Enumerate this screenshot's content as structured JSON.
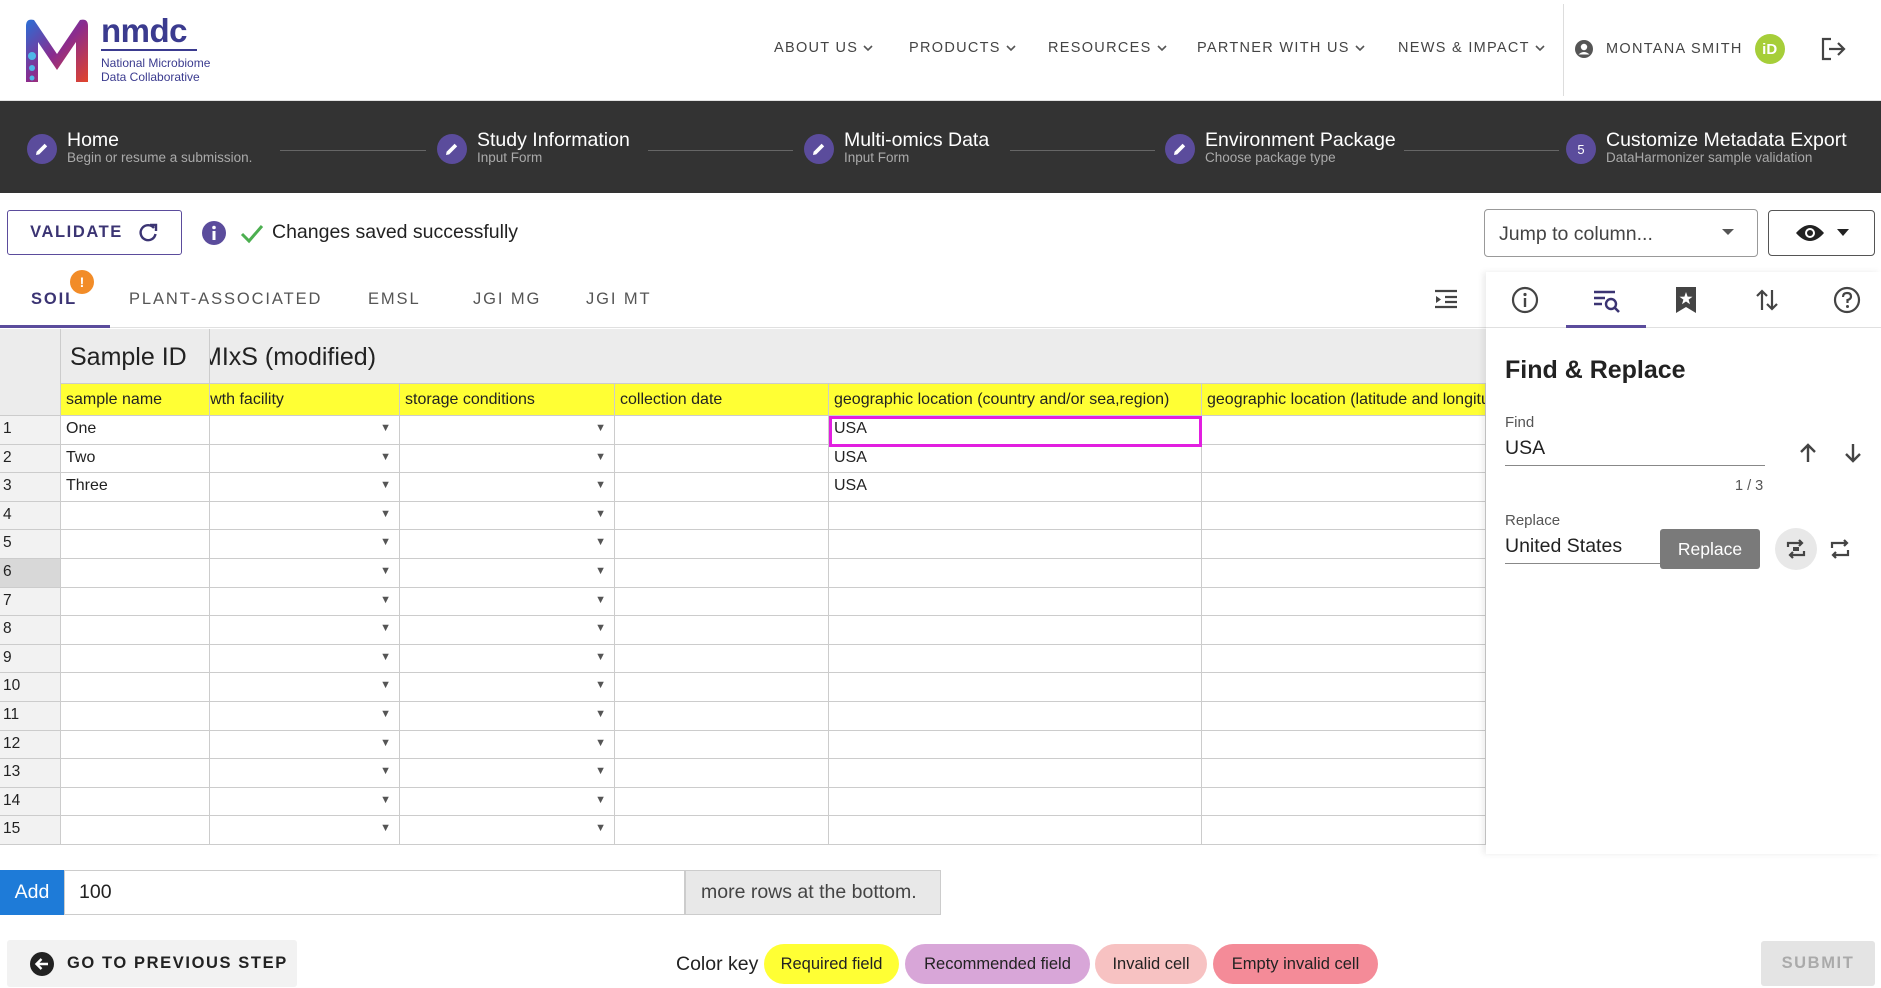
{
  "brand": {
    "name": "nmdc",
    "subtitle_line1": "National Microbiome",
    "subtitle_line2": "Data Collaborative",
    "colors": {
      "primary": "#3b3b8f",
      "accent": "#5b4c9c"
    }
  },
  "nav": {
    "items": [
      "ABOUT US",
      "PRODUCTS",
      "RESOURCES",
      "PARTNER WITH US",
      "NEWS & IMPACT"
    ],
    "user_name": "MONTANA SMITH",
    "orcid_label": "iD"
  },
  "stepper": {
    "steps": [
      {
        "title": "Home",
        "subtitle": "Begin or resume a submission."
      },
      {
        "title": "Study Information",
        "subtitle": "Input Form"
      },
      {
        "title": "Multi-omics Data",
        "subtitle": "Input Form"
      },
      {
        "title": "Environment Package",
        "subtitle": "Choose package type"
      },
      {
        "title": "Customize Metadata Export",
        "subtitle": "DataHarmonizer sample validation",
        "number": "5"
      }
    ]
  },
  "toolbar": {
    "validate_label": "VALIDATE",
    "saved_message": "Changes saved successfully",
    "jump_placeholder": "Jump to column..."
  },
  "tabs": {
    "items": [
      "SOIL",
      "PLANT-ASSOCIATED",
      "EMSL",
      "JGI MG",
      "JGI MT"
    ],
    "active": "SOIL",
    "badge": "!"
  },
  "grid": {
    "groups": {
      "sample_id": "Sample ID",
      "mixs": "MIxS (modified)"
    },
    "columns": [
      "sample name",
      "growth facility",
      "storage conditions",
      "collection date",
      "geographic location (country and/or sea,region)",
      "geographic location (latitude and longitude)"
    ],
    "row_numbers": [
      "1",
      "2",
      "3",
      "4",
      "5",
      "6",
      "7",
      "8",
      "9",
      "10",
      "11",
      "12",
      "13",
      "14",
      "15"
    ],
    "sample_names": [
      "One",
      "Two",
      "Three"
    ],
    "geo_locations": [
      "USA",
      "USA",
      "USA"
    ],
    "selected_row": "6"
  },
  "find_replace": {
    "title": "Find & Replace",
    "find_label": "Find",
    "find_value": "USA",
    "counter": "1 / 3",
    "replace_label": "Replace",
    "replace_value": "United States",
    "replace_button": "Replace"
  },
  "add_rows": {
    "button": "Add",
    "count": "100",
    "suffix": "more rows at the bottom."
  },
  "footer": {
    "prev_label": "GO TO PREVIOUS STEP",
    "color_key_label": "Color key",
    "keys": [
      {
        "label": "Required field",
        "color": "#ffff34"
      },
      {
        "label": "Recommended field",
        "color": "#d8a6d8"
      },
      {
        "label": "Invalid cell",
        "color": "#f7c2c2"
      },
      {
        "label": "Empty invalid cell",
        "color": "#f48b98"
      }
    ],
    "submit_label": "SUBMIT"
  }
}
